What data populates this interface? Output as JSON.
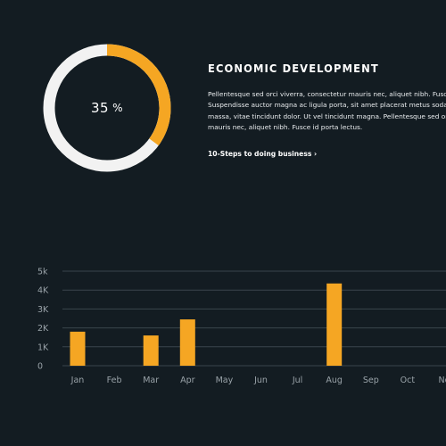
{
  "colors": {
    "background": "#131c22",
    "accent": "#f5a623",
    "ring_track": "#f2f2f2",
    "grid": "#3a454c",
    "axis_text": "#9aa3a9"
  },
  "progress": {
    "value": 35,
    "value_text": "35",
    "unit": "%"
  },
  "info": {
    "title": "ECONOMIC DEVELOPMENT",
    "body_lines": [
      "Pellentesque sed orci viverra, consectetur mauris nec, aliquet nibh. Fusce id po",
      "Suspendisse auctor magna ac ligula porta, sit amet placerat metus sodales. In",
      "massa, vitae tincidunt dolor. Ut vel tincidunt magna. Pellentesque sed orci viver",
      "mauris nec, aliquet nibh. Fusce id porta lectus."
    ],
    "link_label": "10-Steps to doing business ›"
  },
  "chart_data": {
    "type": "bar",
    "categories": [
      "Jan",
      "Feb",
      "Mar",
      "Apr",
      "May",
      "Jun",
      "Jul",
      "Aug",
      "Sep",
      "Oct",
      "No"
    ],
    "values": [
      1800,
      0,
      1600,
      2450,
      0,
      0,
      0,
      4350,
      0,
      0,
      0
    ],
    "highlighted_category": "Aug",
    "yticks": [
      "0",
      "1K",
      "2K",
      "3K",
      "4K",
      "5k"
    ],
    "ylim": [
      0,
      5000
    ],
    "grid": true,
    "title": "",
    "xlabel": "",
    "ylabel": ""
  }
}
